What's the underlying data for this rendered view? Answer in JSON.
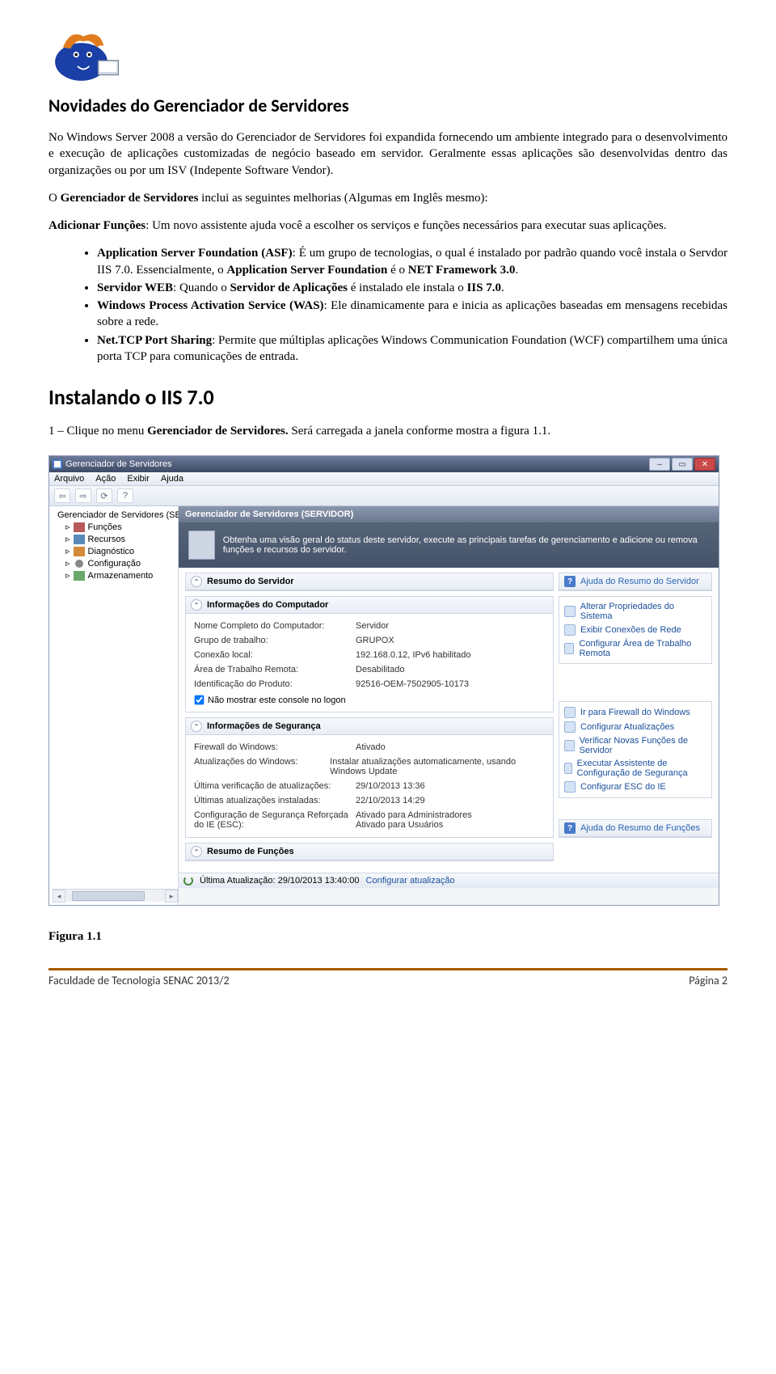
{
  "doc": {
    "heading1": "Novidades do Gerenciador de Servidores",
    "p1": "No Windows Server 2008 a versão do Gerenciador de Servidores foi expandida fornecendo um ambiente integrado para o desenvolvimento e execução de aplicações customizadas de negócio baseado em servidor. Geralmente essas aplicações são desenvolvidas dentro das organizações ou por um ISV (Indepente Software Vendor).",
    "p2_pre": "O ",
    "p2_bold": "Gerenciador de Servidores",
    "p2_post": " inclui as seguintes melhorias (Algumas em Inglês mesmo):",
    "p3_pre": "Adicionar Funções",
    "p3_post": ": Um novo assistente ajuda você a escolher os serviços e funções necessários para executar suas aplicações.",
    "bullets": {
      "asf_pre": "Application Server Foundation (ASF)",
      "asf_mid": ": É um grupo de tecnologias, o qual é instalado por padrão quando você instala o Servdor IIS 7.0. Essencialmente, o ",
      "asf_bold2": "Application Server Foundation",
      "asf_mid2": " é o ",
      "asf_bold3": "NET Framework 3.0",
      "asf_end": ".",
      "web_pre": "Servidor WEB",
      "web_mid": ": Quando o ",
      "web_bold2": "Servidor de Aplicações",
      "web_mid2": " é instalado ele instala o ",
      "web_bold3": "IIS 7.0",
      "web_end": ".",
      "was_pre": "Windows Process Activation Service (WAS)",
      "was_post": ": Ele dinamicamente para e inicia as aplicações baseadas em mensagens recebidas sobre a rede.",
      "tcp_pre": "Net.TCP Port Sharing",
      "tcp_post": ": Permite que múltiplas aplicações Windows Communication Foundation (WCF) compartilhem uma única porta TCP para comunicações de entrada."
    },
    "heading2": "Instalando o IIS 7.0",
    "step1_pre": "1 – Clique no menu ",
    "step1_bold": "Gerenciador de Servidores.",
    "step1_post": " Será carregada a janela conforme mostra a figura 1.1.",
    "figlabel": "Figura 1.1"
  },
  "footer": {
    "left": "Faculdade de Tecnologia SENAC 2013/2",
    "right": "Página 2"
  },
  "ss": {
    "title": "Gerenciador de Servidores",
    "menu": [
      "Arquivo",
      "Ação",
      "Exibir",
      "Ajuda"
    ],
    "tree": {
      "root": "Gerenciador de Servidores (SERV",
      "children": [
        "Funções",
        "Recursos",
        "Diagnóstico",
        "Configuração",
        "Armazenamento"
      ]
    },
    "crumb": "Gerenciador de Servidores (SERVIDOR)",
    "desc": "Obtenha uma visão geral do status deste servidor, execute as principais tarefas de gerenciamento e adicione ou remova funções e recursos do servidor.",
    "summary_header": "Resumo do Servidor",
    "summary_help": "Ajuda do Resumo do Servidor",
    "comp_header": "Informações do Computador",
    "comp_rows": [
      {
        "k": "Nome Completo do Computador:",
        "v": "Servidor"
      },
      {
        "k": "Grupo de trabalho:",
        "v": "GRUPOX"
      },
      {
        "k": "Conexão local:",
        "v": "192.168.0.12, IPv6 habilitado"
      },
      {
        "k": "Área de Trabalho Remota:",
        "v": "Desabilitado"
      },
      {
        "k": "Identificação do Produto:",
        "v": "92516-OEM-7502905-10173"
      }
    ],
    "comp_chk": "Não mostrar este console no logon",
    "comp_links": [
      "Alterar Propriedades do Sistema",
      "Exibir Conexões de Rede",
      "Configurar Área de Trabalho Remota"
    ],
    "sec_header": "Informações de Segurança",
    "sec_rows": [
      {
        "k": "Firewall do Windows:",
        "v": "Ativado"
      },
      {
        "k": "Atualizações do Windows:",
        "v": "Instalar atualizações automaticamente, usando Windows Update"
      },
      {
        "k": "Última verificação de atualizações:",
        "v": "29/10/2013 13:36"
      },
      {
        "k": "Últimas atualizações instaladas:",
        "v": "22/10/2013 14:29"
      },
      {
        "k": "Configuração de Segurança Reforçada do IE (ESC):",
        "v": "Ativado para Administradores\nAtivado para Usuários"
      }
    ],
    "sec_links": [
      "Ir para Firewall do Windows",
      "Configurar Atualizações",
      "Verificar Novas Funções de Servidor",
      "Executar Assistente de Configuração de Segurança",
      "Configurar ESC do IE"
    ],
    "roles_header": "Resumo de Funções",
    "roles_help": "Ajuda do Resumo de Funções",
    "bottom_pre": "Última Atualização: 29/10/2013 13:40:00",
    "bottom_link": "Configurar atualização"
  }
}
